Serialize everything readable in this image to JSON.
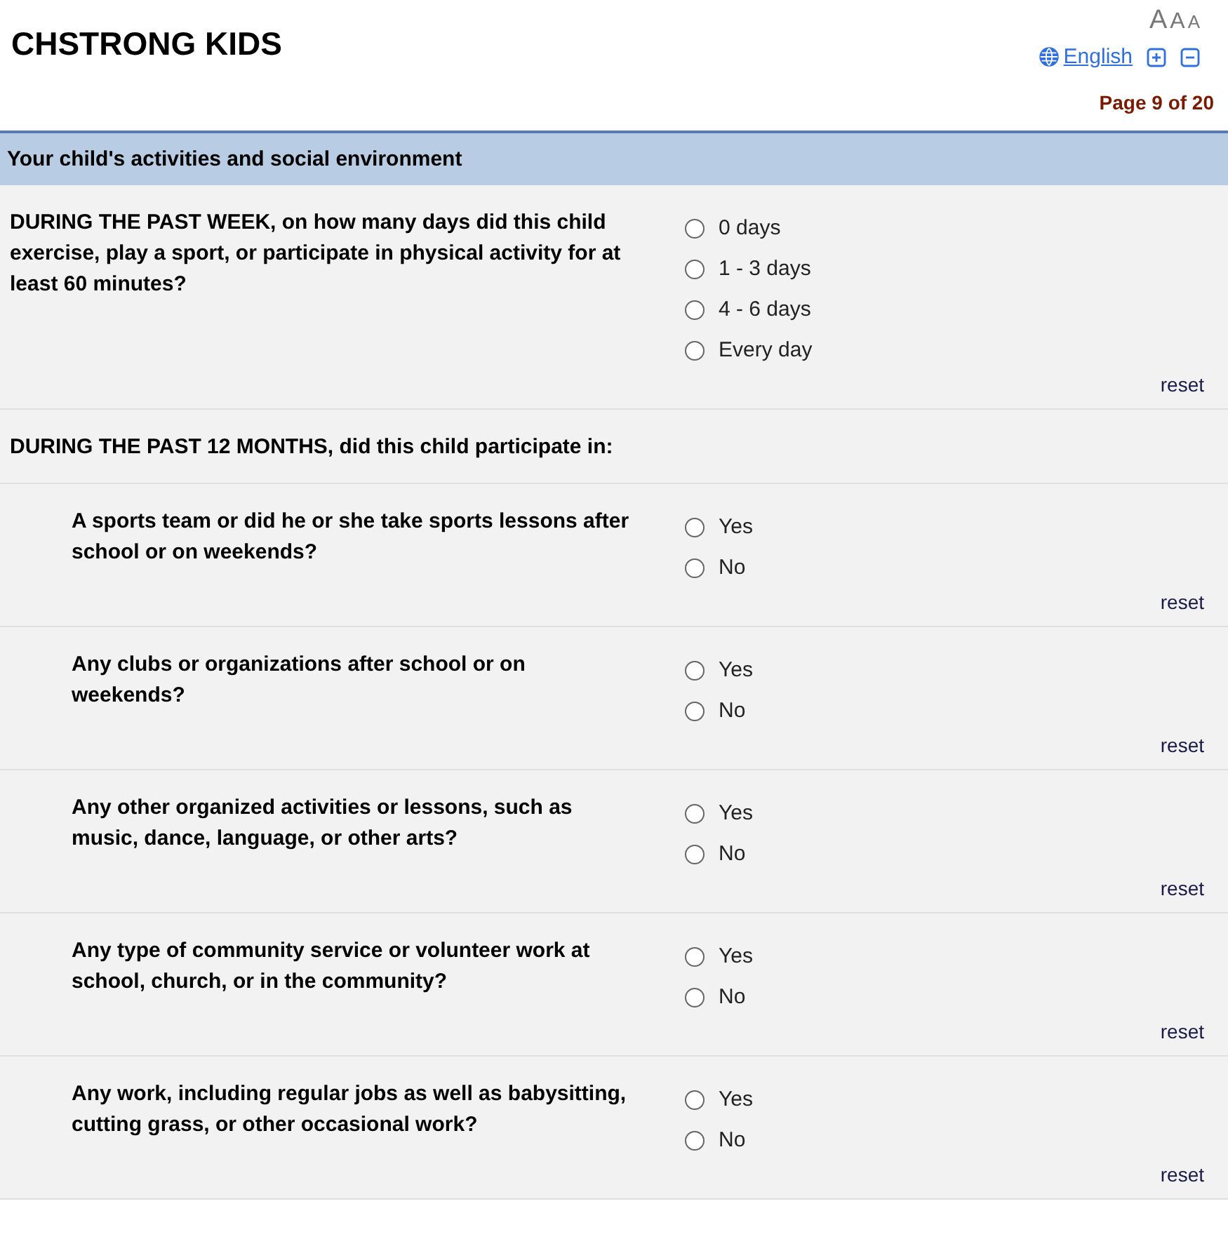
{
  "header": {
    "title": "CHSTRONG KIDS",
    "font_sizes": [
      "A",
      "A",
      "A"
    ],
    "language": "English",
    "page": "Page 9 of 20"
  },
  "section": {
    "title": "Your child's activities and social environment"
  },
  "items": [
    {
      "kind": "question",
      "text": "DURING THE PAST WEEK, on how many days did this child exercise, play a sport, or participate in physical activity for at least 60 minutes?",
      "options": [
        {
          "label": "0 days",
          "selected": false
        },
        {
          "label": "1 - 3 days",
          "selected": false
        },
        {
          "label": "4 - 6 days",
          "selected": false
        },
        {
          "label": "Every day",
          "selected": false
        }
      ],
      "reset": "reset"
    },
    {
      "kind": "heading",
      "text": "DURING THE PAST 12 MONTHS, did this child participate in:"
    },
    {
      "kind": "subquestion",
      "text": "A sports team or did he or she take sports lessons after school or on weekends?",
      "options": [
        {
          "label": "Yes",
          "selected": false
        },
        {
          "label": "No",
          "selected": false
        }
      ],
      "reset": "reset"
    },
    {
      "kind": "subquestion",
      "text": "Any clubs or organizations after school or on weekends?",
      "options": [
        {
          "label": "Yes",
          "selected": false
        },
        {
          "label": "No",
          "selected": false
        }
      ],
      "reset": "reset"
    },
    {
      "kind": "subquestion",
      "text": "Any other organized activities or lessons, such as music, dance, language, or other arts?",
      "options": [
        {
          "label": "Yes",
          "selected": false
        },
        {
          "label": "No",
          "selected": false
        }
      ],
      "reset": "reset"
    },
    {
      "kind": "subquestion",
      "text": "Any type of community service or volunteer work at school, church, or in the community?",
      "options": [
        {
          "label": "Yes",
          "selected": false
        },
        {
          "label": "No",
          "selected": false
        }
      ],
      "reset": "reset"
    },
    {
      "kind": "subquestion",
      "text": "Any work, including regular jobs as well as babysitting, cutting grass, or other occasional work?",
      "options": [
        {
          "label": "Yes",
          "selected": false
        },
        {
          "label": "No",
          "selected": false
        }
      ],
      "reset": "reset"
    }
  ]
}
